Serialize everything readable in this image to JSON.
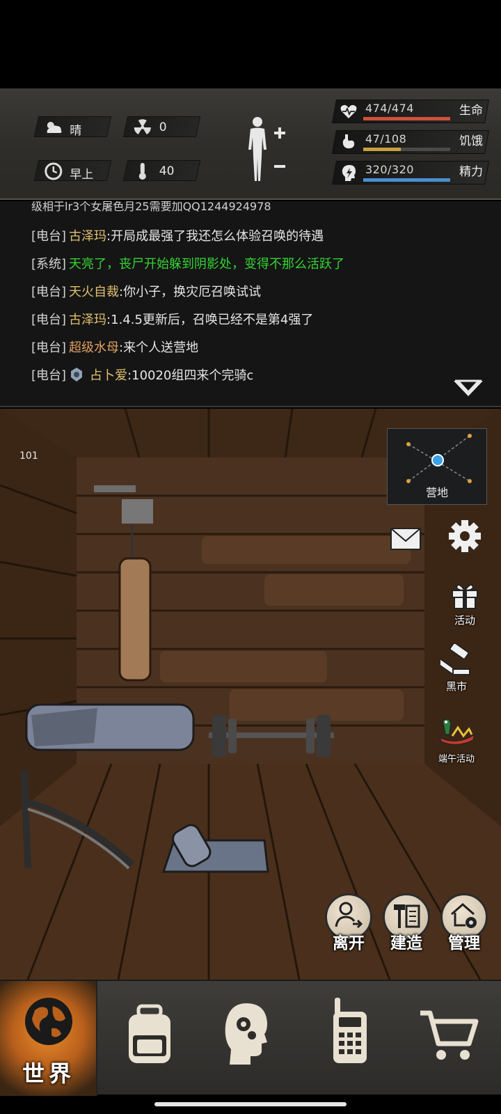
{
  "status": {
    "weather": {
      "icon": "weather-cloudy-icon",
      "text": "晴"
    },
    "radiation": {
      "icon": "radiation-icon",
      "value": "0"
    },
    "time_of_day": {
      "icon": "clock-icon",
      "text": "早上"
    },
    "temperature": {
      "icon": "thermometer-icon",
      "value": "40"
    },
    "health": {
      "value": "474/474",
      "label": "生命",
      "fraction": 1.0,
      "color": "#d0503a"
    },
    "hunger": {
      "value": "47/108",
      "label": "饥饿",
      "fraction": 0.435,
      "color": "#c8a13c"
    },
    "energy": {
      "value": "320/320",
      "label": "精力",
      "fraction": 1.0,
      "color": "#4a8fd0"
    }
  },
  "chat": {
    "partial_line": "级相于lr3个女屠色月25需要加QQ1244924978",
    "messages": [
      {
        "channel": "[电台]",
        "name": "古泽玛",
        "text": ":开局成最强了我还怎么体验召唤的待遇"
      },
      {
        "channel": "[系统]",
        "name": "",
        "text": "天亮了，丧尸开始躲到阴影处，变得不那么活跃了"
      },
      {
        "channel": "[电台]",
        "name": "天火自裁",
        "text": ":你小子，换灾厄召唤试试"
      },
      {
        "channel": "[电台]",
        "name": "古泽玛",
        "text": ":1.4.5更新后，召唤已经不是第4强了"
      },
      {
        "channel": "[电台]",
        "name": "超级水母",
        "text": ":来个人送营地"
      },
      {
        "channel": "[电台]",
        "name": "占卜爱",
        "text": ":10020组四来个完骑c"
      }
    ]
  },
  "scene": {
    "counter": "101",
    "minimap_label": "营地",
    "side_buttons": {
      "events": "活动",
      "black_market": "黑市",
      "dragon_boat": "端午活动"
    },
    "actions": {
      "leave": "离开",
      "build": "建造",
      "manage": "管理"
    }
  },
  "nav": {
    "world": "世界",
    "icons": [
      "backpack-icon",
      "skills-head-icon",
      "radio-icon",
      "cart-icon"
    ]
  }
}
